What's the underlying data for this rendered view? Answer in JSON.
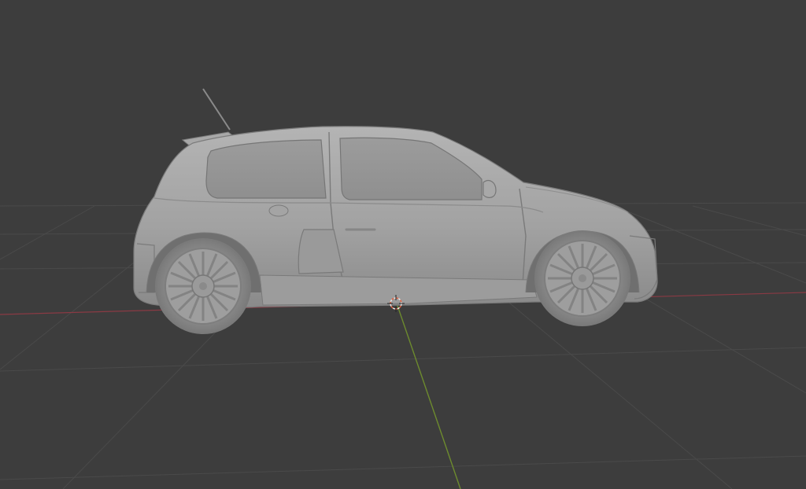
{
  "viewport": {
    "background_color": "#3d3d3d",
    "grid_color": "#4a4a4a",
    "x_axis_color": "#8a3a44",
    "y_axis_color": "#6d8b2e",
    "cursor_color": "#e06040"
  },
  "scene": {
    "object": "hatchback-car-model",
    "view": "side",
    "shading": "solid",
    "model_color": "#a6a6a6"
  },
  "icons": {
    "cursor": "3d-cursor-icon"
  }
}
